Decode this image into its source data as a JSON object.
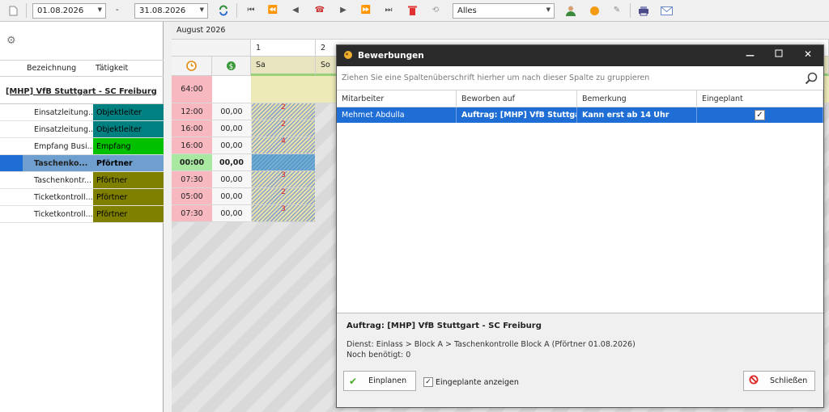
{
  "toolbar": {
    "date_from": "01.08.2026",
    "date_separator": "-",
    "date_to": "31.08.2026",
    "filter_value": "Alles"
  },
  "left": {
    "col_bezeichnung": "Bezeichnung",
    "col_taetigkeit": "Tätigkeit",
    "group_title": "[MHP] VfB Stuttgart - SC Freiburg",
    "rows": [
      {
        "name": "Einsatzleitung...",
        "task": "Objektleiter",
        "color": "#008080",
        "text": "#000000"
      },
      {
        "name": "Einsatzleitung...",
        "task": "Objektleiter",
        "color": "#008080",
        "text": "#000000"
      },
      {
        "name": "Empfang Busi...",
        "task": "Empfang",
        "color": "#00c000",
        "text": "#000000"
      },
      {
        "name": "Taschenko...",
        "task": "Pförtner",
        "color": "#6f9fce",
        "text": "#000000"
      },
      {
        "name": "Taschenkontr...",
        "task": "Pförtner",
        "color": "#808000",
        "text": "#000000"
      },
      {
        "name": "Ticketkontroll...",
        "task": "Pförtner",
        "color": "#808000",
        "text": "#000000"
      },
      {
        "name": "Ticketkontroll...",
        "task": "Pförtner",
        "color": "#808000",
        "text": "#000000"
      }
    ]
  },
  "schedule": {
    "month": "August 2026",
    "day1_num": "1",
    "day1_name": "Sa",
    "day2_num": "2",
    "day2_name": "So",
    "total_hours": "64:00",
    "rows": [
      {
        "hours": "12:00",
        "amount": "00,00",
        "count": "2"
      },
      {
        "hours": "16:00",
        "amount": "00,00",
        "count": "2"
      },
      {
        "hours": "16:00",
        "amount": "00,00",
        "count": "4"
      },
      {
        "hours": "00:00",
        "amount": "00,00",
        "count": ""
      },
      {
        "hours": "07:30",
        "amount": "00,00",
        "count": "3"
      },
      {
        "hours": "05:00",
        "amount": "00,00",
        "count": "2"
      },
      {
        "hours": "07:30",
        "amount": "00,00",
        "count": "3"
      }
    ]
  },
  "dialog": {
    "title": "Bewerbungen",
    "group_hint": "Ziehen Sie eine Spaltenüberschrift hierher um nach dieser Spalte zu gruppieren",
    "columns": {
      "mitarbeiter": "Mitarbeiter",
      "beworben": "Beworben auf",
      "bemerkung": "Bemerkung",
      "eingeplant": "Eingeplant"
    },
    "row": {
      "mitarbeiter": "Mehmet Abdulla",
      "beworben": "Auftrag: [MHP] VfB Stuttga...",
      "bemerkung": "Kann erst ab 14 Uhr",
      "eingeplant": true
    },
    "detail_title": "Auftrag: [MHP] VfB Stuttgart - SC Freiburg",
    "detail_dienst": "Dienst: Einlass > Block A > Taschenkontrolle Block A (Pförtner 01.08.2026)",
    "detail_needed": "Noch benötigt: 0",
    "btn_einplanen": "Einplanen",
    "chk_show_label": "Eingeplante anzeigen",
    "chk_show_checked": true,
    "btn_close": "Schließen"
  },
  "colors": {
    "selection": "#1e6ed6",
    "hours_pink": "#f8b8c0",
    "hours_green": "#a8e8a0"
  }
}
